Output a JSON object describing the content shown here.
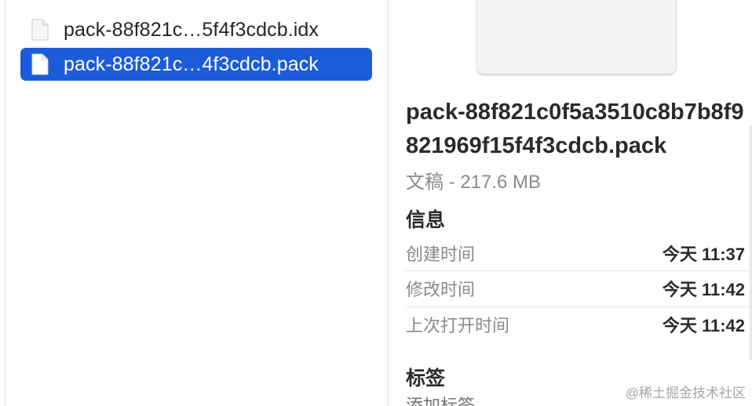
{
  "file_list": {
    "items": [
      {
        "name": "pack-88f821c…5f4f3cdcb.idx",
        "icon": "document-icon",
        "selected": false
      },
      {
        "name": "pack-88f821c…4f3cdcb.pack",
        "icon": "document-icon",
        "selected": true
      }
    ]
  },
  "preview": {
    "title": "pack-88f821c0f5a3510c8b7b8f9821969f15f4f3cdcb.pack",
    "subtitle": "文稿 - 217.6 MB",
    "info_heading": "信息",
    "info_rows": [
      {
        "label": "创建时间",
        "value": "今天 11:37"
      },
      {
        "label": "修改时间",
        "value": "今天 11:42"
      },
      {
        "label": "上次打开时间",
        "value": "今天 11:42"
      }
    ],
    "tags_heading": "标签",
    "tags_placeholder": "添加标签…"
  },
  "watermark": "@稀土掘金技术社区",
  "colors": {
    "selection": "#1c5cd9",
    "secondary_text": "#8a8a8a"
  }
}
